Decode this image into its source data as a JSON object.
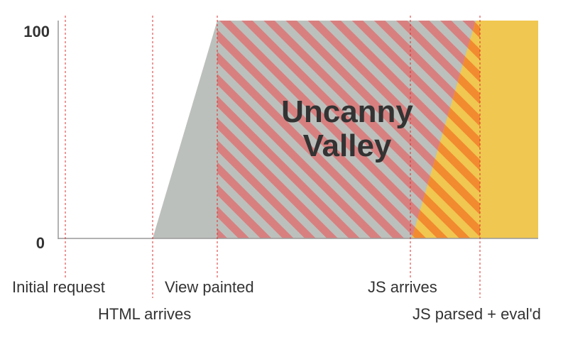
{
  "axis": {
    "y_ticks": [
      {
        "label": "100",
        "value": 100
      },
      {
        "label": "0",
        "value": 0
      }
    ],
    "ylim": [
      0,
      100
    ]
  },
  "center_label": [
    "Uncanny",
    "Valley"
  ],
  "events": [
    {
      "label": "Initial request",
      "row": 1
    },
    {
      "label": "HTML arrives",
      "row": 2
    },
    {
      "label": "View painted",
      "row": 1
    },
    {
      "label": "JS arrives",
      "row": 1
    },
    {
      "label": "JS parsed + eval'd",
      "row": 2
    }
  ],
  "colors": {
    "gray_fill": "#bcc0bc",
    "red_stripe": "#d88080",
    "yellow_fill": "#f0c750",
    "orange_stripe": "#f28a30",
    "event_line": "#d83030",
    "axis_line": "#999999",
    "text": "#333333"
  },
  "chart_data": {
    "type": "area",
    "series": [
      {
        "name": "",
        "points": [
          [
            0,
            0
          ],
          [
            1,
            0
          ],
          [
            2,
            100
          ],
          [
            3,
            100
          ],
          [
            4,
            100
          ]
        ]
      },
      {
        "name": "",
        "points": [
          [
            0,
            0
          ],
          [
            1,
            0
          ],
          [
            2,
            0
          ],
          [
            3,
            0
          ],
          [
            4,
            100
          ]
        ]
      }
    ]
  }
}
